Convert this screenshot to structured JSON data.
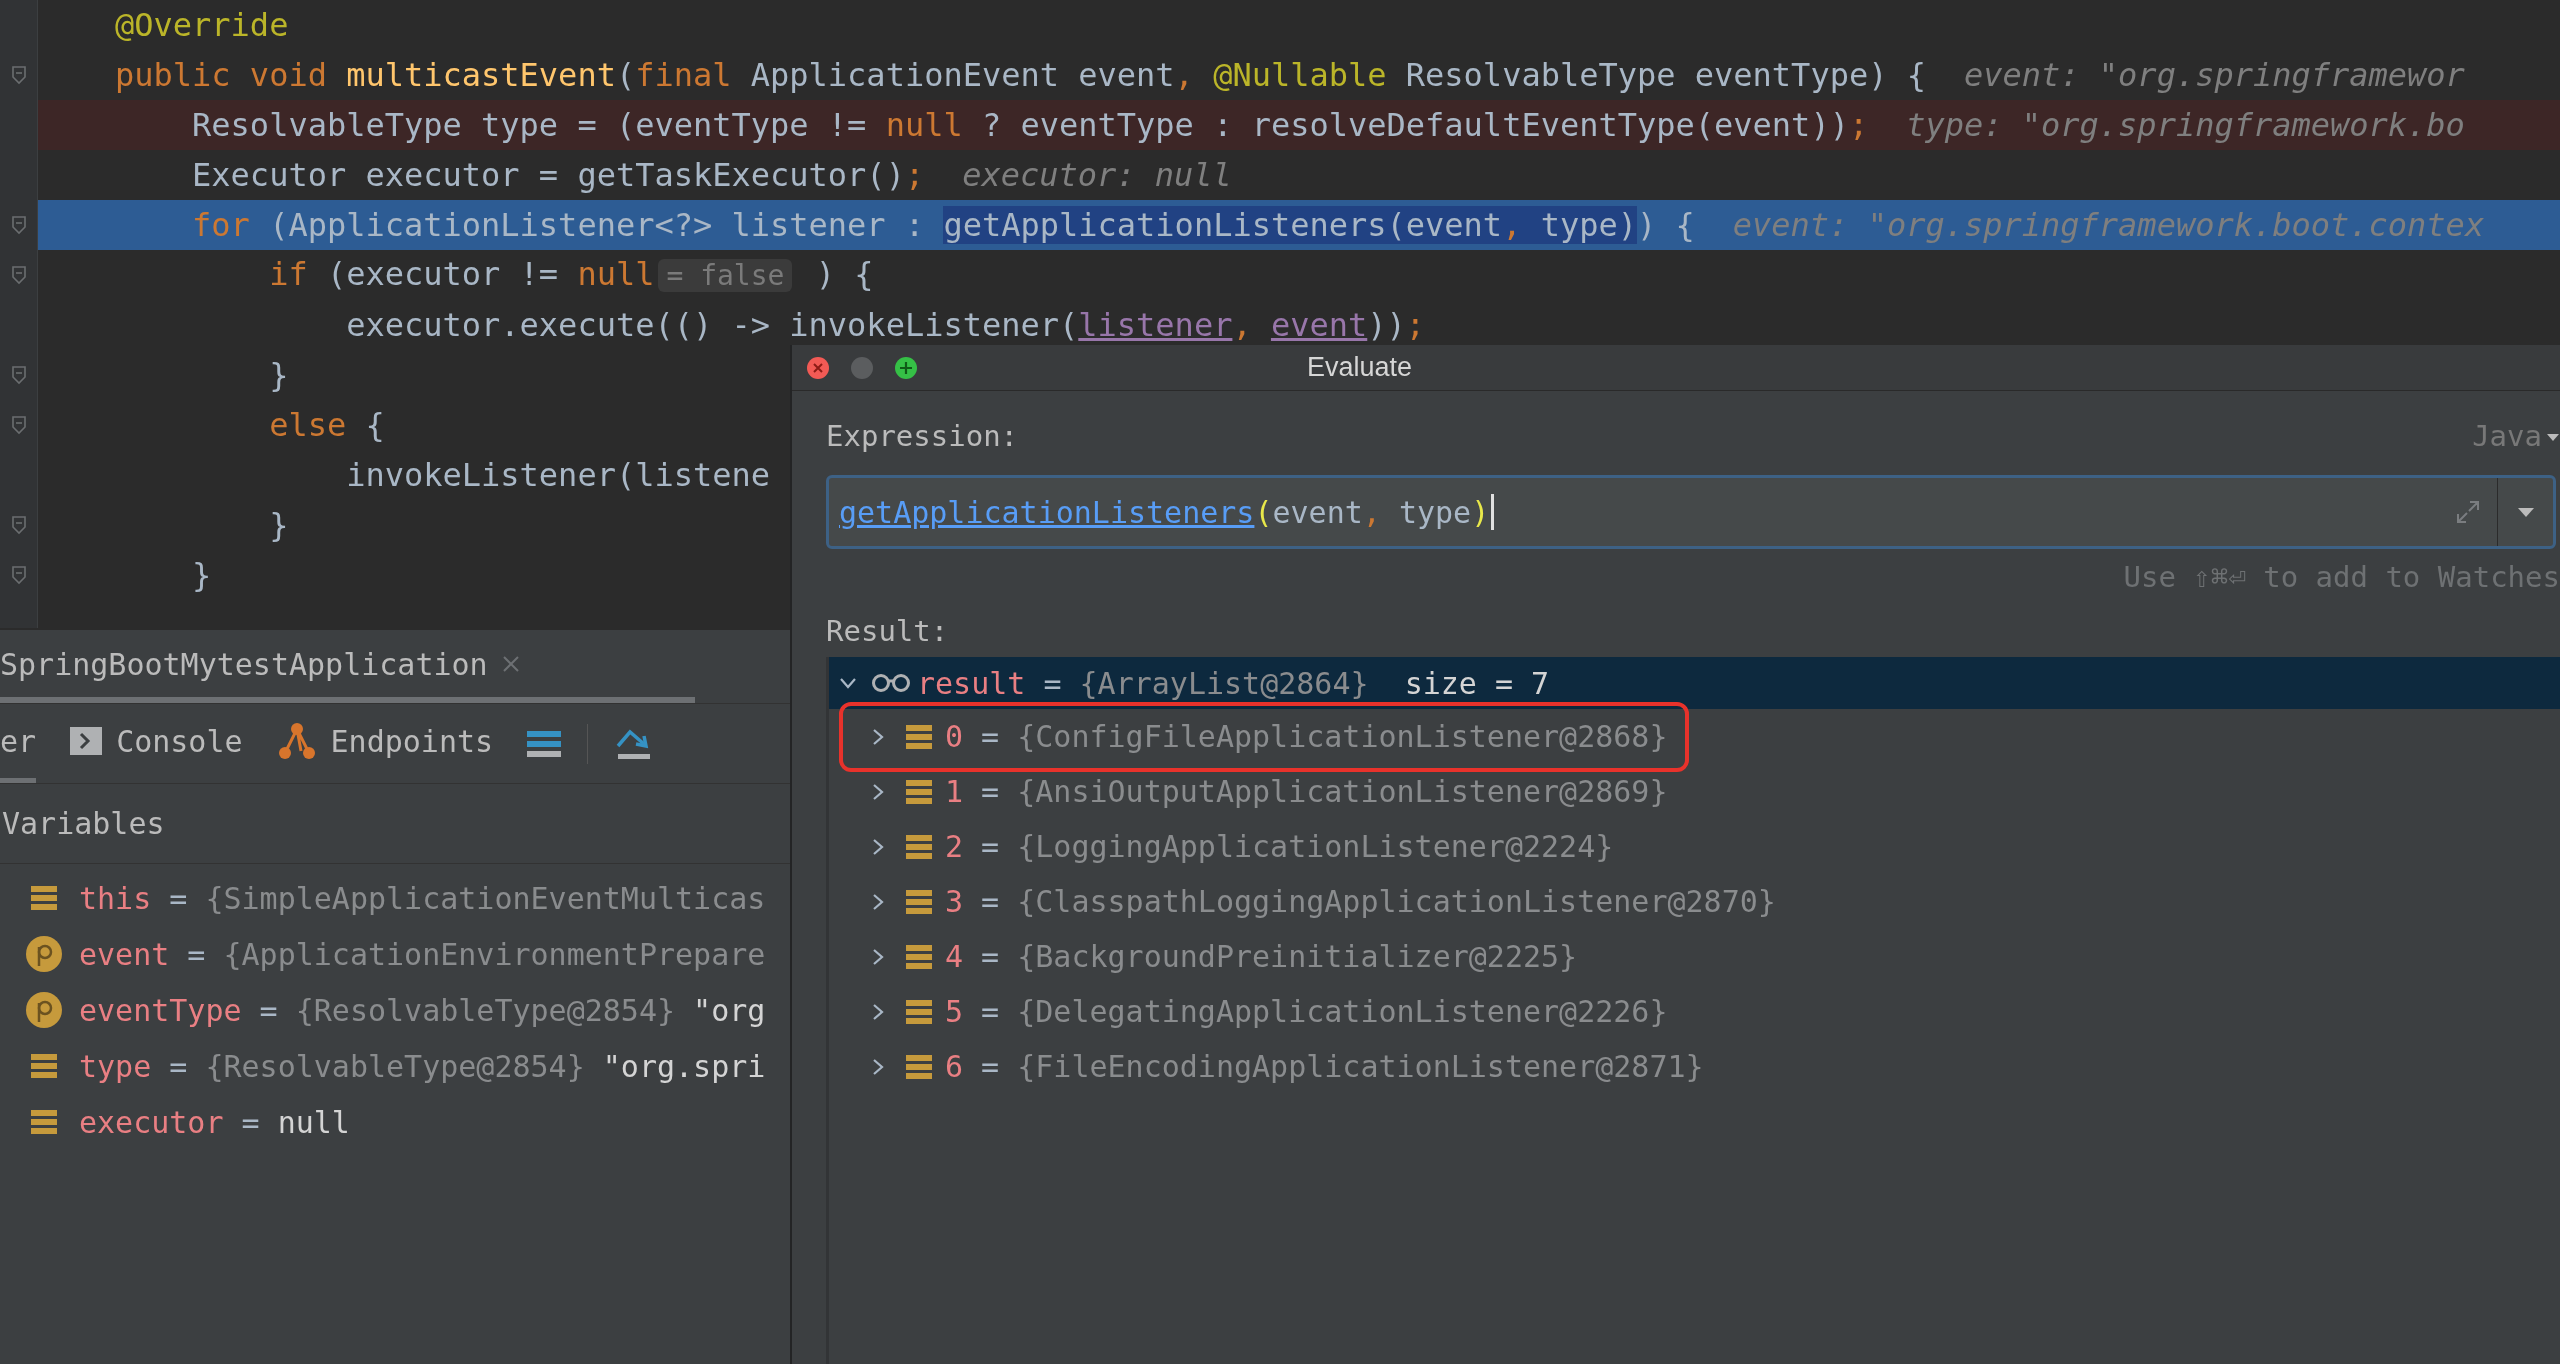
{
  "editor": {
    "lines": [
      {
        "highlighted": false,
        "current": false,
        "fold": false,
        "tokens": [
          {
            "kind": "annotation",
            "text": "@Override"
          }
        ]
      },
      {
        "highlighted": false,
        "current": false,
        "fold": true,
        "tokens": [
          {
            "kind": "kw",
            "text": "public void "
          },
          {
            "kind": "method",
            "text": "multicastEvent"
          },
          {
            "kind": "plain",
            "text": "("
          },
          {
            "kind": "kw",
            "text": "final "
          },
          {
            "kind": "plain",
            "text": "ApplicationEvent event"
          },
          {
            "kind": "kw",
            "text": ", "
          },
          {
            "kind": "annotation",
            "text": "@Nullable"
          },
          {
            "kind": "plain",
            "text": " ResolvableType eventType) {"
          },
          {
            "kind": "hint",
            "text": "event: \"org.springframewor"
          }
        ]
      },
      {
        "highlighted": true,
        "current": false,
        "fold": false,
        "tokens": [
          {
            "kind": "plain",
            "text": "    ResolvableType type = (eventType != "
          },
          {
            "kind": "kw",
            "text": "null"
          },
          {
            "kind": "plain",
            "text": " ? eventType : resolveDefaultEventType(event))"
          },
          {
            "kind": "kw",
            "text": ";"
          },
          {
            "kind": "hint",
            "text": "type: \"org.springframework.bo"
          }
        ]
      },
      {
        "highlighted": false,
        "current": false,
        "fold": false,
        "tokens": [
          {
            "kind": "plain",
            "text": "    Executor executor = getTaskExecutor()"
          },
          {
            "kind": "kw",
            "text": ";"
          },
          {
            "kind": "hint",
            "text": "executor: null"
          }
        ]
      },
      {
        "highlighted": false,
        "current": true,
        "fold": true,
        "tokens": [
          {
            "kind": "kw",
            "text": "    for"
          },
          {
            "kind": "plain",
            "text": " (ApplicationListener<?> listener : "
          },
          {
            "kind": "selected",
            "text": "getApplicationListeners(event"
          },
          {
            "kind": "selected-kw",
            "text": ", "
          },
          {
            "kind": "selected",
            "text": "type)"
          },
          {
            "kind": "plain",
            "text": ") {"
          },
          {
            "kind": "hint",
            "text": "event: \"org.springframework.boot.contex"
          }
        ]
      },
      {
        "highlighted": false,
        "current": false,
        "fold": true,
        "tokens": [
          {
            "kind": "kw",
            "text": "        if"
          },
          {
            "kind": "plain",
            "text": " (executor != "
          },
          {
            "kind": "kw",
            "text": "null"
          },
          {
            "kind": "inline-hint",
            "text": "= false"
          },
          {
            "kind": "plain",
            "text": " ) {"
          }
        ]
      },
      {
        "highlighted": false,
        "current": false,
        "fold": false,
        "tokens": [
          {
            "kind": "plain",
            "text": "            executor.execute(() -> invokeListener("
          },
          {
            "kind": "param",
            "text": "listener"
          },
          {
            "kind": "kw",
            "text": ", "
          },
          {
            "kind": "param",
            "text": "event"
          },
          {
            "kind": "plain",
            "text": "))"
          },
          {
            "kind": "kw",
            "text": ";"
          }
        ]
      },
      {
        "highlighted": false,
        "current": false,
        "fold": true,
        "tokens": [
          {
            "kind": "plain",
            "text": "        }"
          }
        ]
      },
      {
        "highlighted": false,
        "current": false,
        "fold": true,
        "tokens": [
          {
            "kind": "kw",
            "text": "        else"
          },
          {
            "kind": "plain",
            "text": " {"
          }
        ]
      },
      {
        "highlighted": false,
        "current": false,
        "fold": false,
        "tokens": [
          {
            "kind": "plain",
            "text": "            invokeListener(listene"
          }
        ]
      },
      {
        "highlighted": false,
        "current": false,
        "fold": true,
        "tokens": [
          {
            "kind": "plain",
            "text": "        }"
          }
        ]
      },
      {
        "highlighted": false,
        "current": false,
        "fold": true,
        "tokens": [
          {
            "kind": "plain",
            "text": "    }"
          }
        ]
      }
    ]
  },
  "debug_panel": {
    "session_tab": {
      "label": "SpringBootMytestApplication"
    },
    "toolbar_tabs": [
      {
        "kind": "plain",
        "label": "er",
        "selected": true
      },
      {
        "kind": "console",
        "label": "Console",
        "selected": false
      },
      {
        "kind": "endpoints",
        "label": "Endpoints",
        "selected": false
      }
    ],
    "variables_header": "Variables",
    "variables": [
      {
        "kind": "field",
        "name": "this",
        "sep": "=",
        "value": "{SimpleApplicationEventMulticas"
      },
      {
        "kind": "param",
        "name": "event",
        "sep": "=",
        "value": "{ApplicationEnvironmentPrepare"
      },
      {
        "kind": "param",
        "name": "eventType",
        "sep": "=",
        "value": "{ResolvableType@2854}",
        "string": "\"org"
      },
      {
        "kind": "field",
        "name": "type",
        "sep": "=",
        "value": "{ResolvableType@2854}",
        "string": "\"org.spri"
      },
      {
        "kind": "field",
        "name": "executor",
        "sep": "=",
        "string": "null"
      }
    ]
  },
  "dialog": {
    "title": "Evaluate",
    "expression_label": "Expression:",
    "language": "Java",
    "expression": [
      {
        "kind": "link",
        "text": "getApplicationListeners"
      },
      {
        "kind": "paren",
        "text": "("
      },
      {
        "kind": "plain",
        "text": "event"
      },
      {
        "kind": "kw",
        "text": ", "
      },
      {
        "kind": "plain",
        "text": "type"
      },
      {
        "kind": "paren",
        "text": ")"
      }
    ],
    "hint": "Use ⇧⌘⏎ to add to Watches",
    "result_label": "Result:",
    "result": {
      "name": "result",
      "sep": "=",
      "value": "{ArrayList@2864}",
      "size": "size = 7",
      "expanded": true,
      "selected": true,
      "children": [
        {
          "index": "0",
          "sep": "=",
          "value": "{ConfigFileApplicationListener@2868}",
          "expanded": false,
          "selected": false,
          "boxed": true
        },
        {
          "index": "1",
          "sep": "=",
          "value": "{AnsiOutputApplicationListener@2869}",
          "expanded": false,
          "selected": false,
          "boxed": false
        },
        {
          "index": "2",
          "sep": "=",
          "value": "{LoggingApplicationListener@2224}",
          "expanded": false,
          "selected": false,
          "boxed": false
        },
        {
          "index": "3",
          "sep": "=",
          "value": "{ClasspathLoggingApplicationListener@2870}",
          "expanded": false,
          "selected": false,
          "boxed": false
        },
        {
          "index": "4",
          "sep": "=",
          "value": "{BackgroundPreinitializer@2225}",
          "expanded": false,
          "selected": false,
          "boxed": false
        },
        {
          "index": "5",
          "sep": "=",
          "value": "{DelegatingApplicationListener@2226}",
          "expanded": false,
          "selected": false,
          "boxed": false
        },
        {
          "index": "6",
          "sep": "=",
          "value": "{FileEncodingApplicationListener@2871}",
          "expanded": false,
          "selected": false,
          "boxed": false
        }
      ]
    }
  }
}
